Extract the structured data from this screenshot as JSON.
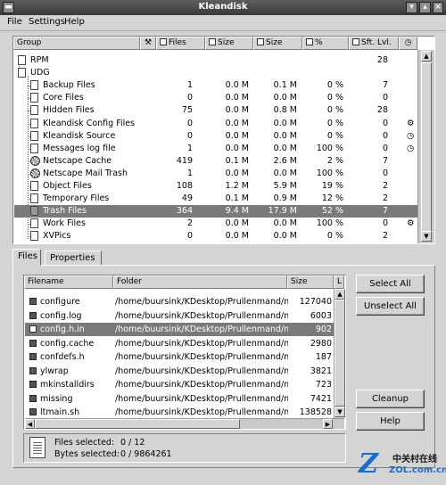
{
  "window": {
    "title": "Kleandisk"
  },
  "menu": {
    "file": "File",
    "settings": "Settings",
    "help": "Help"
  },
  "group_table": {
    "columns": [
      "Group",
      "Files",
      "Size",
      "Size",
      "%",
      "Sft. Lvl."
    ],
    "rows": [
      {
        "name": "RPM",
        "files": "",
        "size1": "",
        "size2": "",
        "pct": "",
        "lvl": "28",
        "indent": 0,
        "icon": "folder"
      },
      {
        "name": "UDG",
        "files": "",
        "size1": "",
        "size2": "",
        "pct": "",
        "lvl": "",
        "indent": 0,
        "icon": "folder"
      },
      {
        "name": "Backup Files",
        "files": "1",
        "size1": "0.0 M",
        "size2": "0.1 M",
        "pct": "0 %",
        "lvl": "7",
        "indent": 1,
        "icon": "doc"
      },
      {
        "name": "Core Files",
        "files": "0",
        "size1": "0.0 M",
        "size2": "0.0 M",
        "pct": "0 %",
        "lvl": "0",
        "indent": 1,
        "icon": "doc"
      },
      {
        "name": "Hidden Files",
        "files": "75",
        "size1": "0.0 M",
        "size2": "0.8 M",
        "pct": "0 %",
        "lvl": "28",
        "indent": 1,
        "icon": "doc"
      },
      {
        "name": "Kleandisk Config Files",
        "files": "0",
        "size1": "0.0 M",
        "size2": "0.0 M",
        "pct": "0 %",
        "lvl": "0",
        "indent": 1,
        "icon": "doc"
      },
      {
        "name": "Kleandisk Source",
        "files": "0",
        "size1": "0.0 M",
        "size2": "0.0 M",
        "pct": "0 %",
        "lvl": "0",
        "indent": 1,
        "icon": "doc"
      },
      {
        "name": "Messages log file",
        "files": "1",
        "size1": "0.0 M",
        "size2": "0.0 M",
        "pct": "100 %",
        "lvl": "0",
        "indent": 1,
        "icon": "doc"
      },
      {
        "name": "Netscape Cache",
        "files": "419",
        "size1": "0.1 M",
        "size2": "2.6 M",
        "pct": "2 %",
        "lvl": "7",
        "indent": 1,
        "icon": "gear"
      },
      {
        "name": "Netscape Mail Trash",
        "files": "1",
        "size1": "0.0 M",
        "size2": "0.0 M",
        "pct": "100 %",
        "lvl": "0",
        "indent": 1,
        "icon": "gear"
      },
      {
        "name": "Object Files",
        "files": "108",
        "size1": "1.2 M",
        "size2": "5.9 M",
        "pct": "19 %",
        "lvl": "2",
        "indent": 1,
        "icon": "doc"
      },
      {
        "name": "Temporary Files",
        "files": "49",
        "size1": "0.1 M",
        "size2": "0.9 M",
        "pct": "12 %",
        "lvl": "2",
        "indent": 1,
        "icon": "doc"
      },
      {
        "name": "Trash Files",
        "files": "364",
        "size1": "9.4 M",
        "size2": "17.9 M",
        "pct": "52 %",
        "lvl": "7",
        "indent": 1,
        "icon": "trash",
        "selected": true
      },
      {
        "name": "Work Files",
        "files": "2",
        "size1": "0.0 M",
        "size2": "0.0 M",
        "pct": "100 %",
        "lvl": "0",
        "indent": 1,
        "icon": "doc"
      },
      {
        "name": "XVPics",
        "files": "0",
        "size1": "0.0 M",
        "size2": "0.0 M",
        "pct": "0 %",
        "lvl": "2",
        "indent": 1,
        "icon": "doc"
      }
    ]
  },
  "tabs": {
    "files": "Files",
    "properties": "Properties"
  },
  "file_table": {
    "columns": [
      "Filename",
      "Folder",
      "Size",
      "L"
    ],
    "rows": [
      {
        "name": "configure",
        "folder": "/home/buursink/KDesktop/Prullenmand/mp...",
        "size": "127040"
      },
      {
        "name": "config.log",
        "folder": "/home/buursink/KDesktop/Prullenmand/mp...",
        "size": "6003"
      },
      {
        "name": "config.h.in",
        "folder": "/home/buursink/KDesktop/Prullenmand/mp...",
        "size": "902",
        "selected": true
      },
      {
        "name": "config.cache",
        "folder": "/home/buursink/KDesktop/Prullenmand/mp...",
        "size": "2980"
      },
      {
        "name": "confdefs.h",
        "folder": "/home/buursink/KDesktop/Prullenmand/mp...",
        "size": "187"
      },
      {
        "name": "ylwrap",
        "folder": "/home/buursink/KDesktop/Prullenmand/mp...",
        "size": "3821"
      },
      {
        "name": "mkinstalldirs",
        "folder": "/home/buursink/KDesktop/Prullenmand/mp...",
        "size": "723"
      },
      {
        "name": "missing",
        "folder": "/home/buursink/KDesktop/Prullenmand/mp...",
        "size": "7421"
      },
      {
        "name": "ltmain.sh",
        "folder": "/home/buursink/KDesktop/Prullenmand/mp...",
        "size": "138528"
      }
    ]
  },
  "buttons": {
    "select_all": "Select All",
    "unselect_all": "Unselect All",
    "cleanup": "Cleanup",
    "help": "Help"
  },
  "status": {
    "files_label": "Files selected:",
    "files_value": "0 / 12",
    "bytes_label": "Bytes selected:",
    "bytes_value": "0 / 9864261"
  },
  "watermark": {
    "logo": "Z",
    "name": "中关村在线",
    "url": "ZOL.com.cn"
  }
}
